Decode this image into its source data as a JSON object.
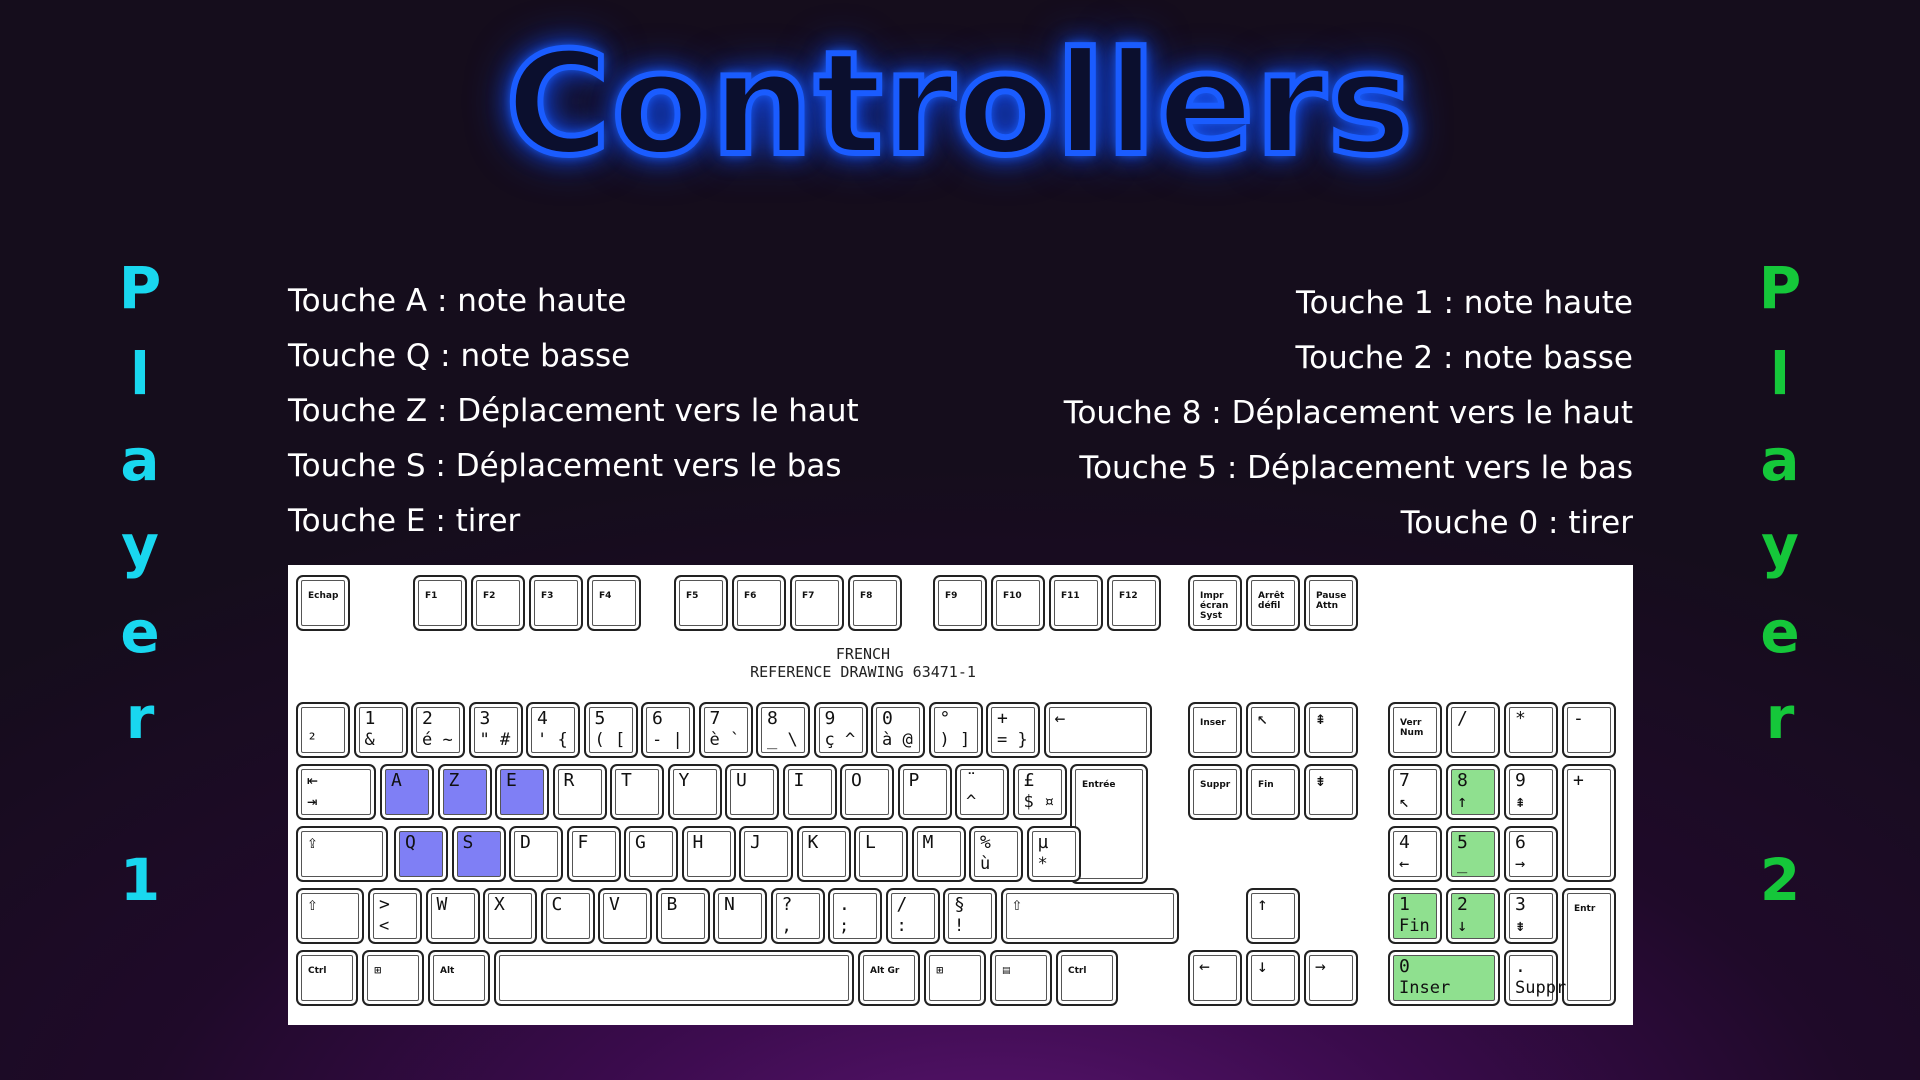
{
  "title": "Controllers",
  "player1": {
    "letters": [
      "P",
      "l",
      "a",
      "y",
      "e",
      "r",
      "1"
    ],
    "color": "#19d7ef"
  },
  "player2": {
    "letters": [
      "P",
      "l",
      "a",
      "y",
      "e",
      "r",
      "2"
    ],
    "color": "#15c73a"
  },
  "controls_p1": [
    "Touche A : note haute",
    "Touche Q : note basse",
    "Touche Z : Déplacement vers le haut",
    "Touche S : Déplacement vers le bas",
    "Touche E : tirer"
  ],
  "controls_p2": [
    "Touche 1 : note haute",
    "Touche 2 : note basse",
    "Touche 8 : Déplacement vers le haut",
    "Touche 5 : Déplacement vers le bas",
    "Touche 0 : tirer"
  ],
  "keyboard": {
    "label_line1": "FRENCH",
    "label_line2": "REFERENCE DRAWING 63471-1",
    "highlight_p1_color": "#7f7ff5",
    "highlight_p2_color": "#8fe08f",
    "f_row": [
      "Echap",
      "F1",
      "F2",
      "F3",
      "F4",
      "F5",
      "F6",
      "F7",
      "F8",
      "F9",
      "F10",
      "F11",
      "F12",
      "Impr écran Syst",
      "Arrêt défil",
      "Pause Attn"
    ],
    "number_row": [
      [
        "",
        "²"
      ],
      [
        "1",
        "&"
      ],
      [
        "2",
        "é ~"
      ],
      [
        "3",
        "\" #"
      ],
      [
        "4",
        "' {"
      ],
      [
        "5",
        "( ["
      ],
      [
        "6",
        "- |"
      ],
      [
        "7",
        "è `"
      ],
      [
        "8",
        "_ \\"
      ],
      [
        "9",
        "ç ^"
      ],
      [
        "0",
        "à @"
      ],
      [
        "°",
        ") ]"
      ],
      [
        "+",
        "= }"
      ],
      [
        "←",
        ""
      ]
    ],
    "top_row": [
      [
        "⇤",
        "⇥"
      ],
      [
        "A",
        ""
      ],
      [
        "Z",
        ""
      ],
      [
        "E",
        ""
      ],
      [
        "R",
        ""
      ],
      [
        "T",
        ""
      ],
      [
        "Y",
        ""
      ],
      [
        "U",
        ""
      ],
      [
        "I",
        ""
      ],
      [
        "O",
        ""
      ],
      [
        "P",
        ""
      ],
      [
        "¨",
        "^"
      ],
      [
        "£",
        "$ ¤"
      ],
      [
        "Entrée",
        "↵"
      ]
    ],
    "home_row": [
      [
        "⇪",
        ""
      ],
      [
        "Q",
        ""
      ],
      [
        "S",
        ""
      ],
      [
        "D",
        ""
      ],
      [
        "F",
        ""
      ],
      [
        "G",
        ""
      ],
      [
        "H",
        ""
      ],
      [
        "J",
        ""
      ],
      [
        "K",
        ""
      ],
      [
        "L",
        ""
      ],
      [
        "M",
        ""
      ],
      [
        "%",
        "ù"
      ],
      [
        "µ",
        "*"
      ]
    ],
    "shift_row": [
      [
        "⇧",
        ""
      ],
      [
        ">",
        "<"
      ],
      [
        "W",
        ""
      ],
      [
        "X",
        ""
      ],
      [
        "C",
        ""
      ],
      [
        "V",
        ""
      ],
      [
        "B",
        ""
      ],
      [
        "N",
        ""
      ],
      [
        "?",
        ","
      ],
      [
        ".",
        ";"
      ],
      [
        "/",
        ":"
      ],
      [
        "§",
        "!"
      ],
      [
        "⇧",
        ""
      ]
    ],
    "bottom_row": [
      "Ctrl",
      "⊞",
      "Alt",
      "",
      "Alt Gr",
      "⊞",
      "▤",
      "Ctrl"
    ],
    "nav": [
      "Inser",
      "↖",
      "⇞",
      "Suppr",
      "Fin",
      "⇟",
      "↑",
      "←",
      "↓",
      "→"
    ],
    "numpad": [
      [
        "Verr Num",
        ""
      ],
      [
        "/",
        ""
      ],
      [
        "*",
        ""
      ],
      [
        "-",
        ""
      ],
      [
        "7",
        "↖"
      ],
      [
        "8",
        "↑"
      ],
      [
        "9",
        "⇞"
      ],
      [
        "+",
        ""
      ],
      [
        "4",
        "←"
      ],
      [
        "5",
        "_"
      ],
      [
        "6",
        "→"
      ],
      [
        "1",
        "Fin"
      ],
      [
        "2",
        "↓"
      ],
      [
        "3",
        "⇟"
      ],
      [
        "Entr",
        ""
      ],
      [
        "0",
        "Inser"
      ],
      [
        ".",
        "Suppr"
      ]
    ]
  }
}
